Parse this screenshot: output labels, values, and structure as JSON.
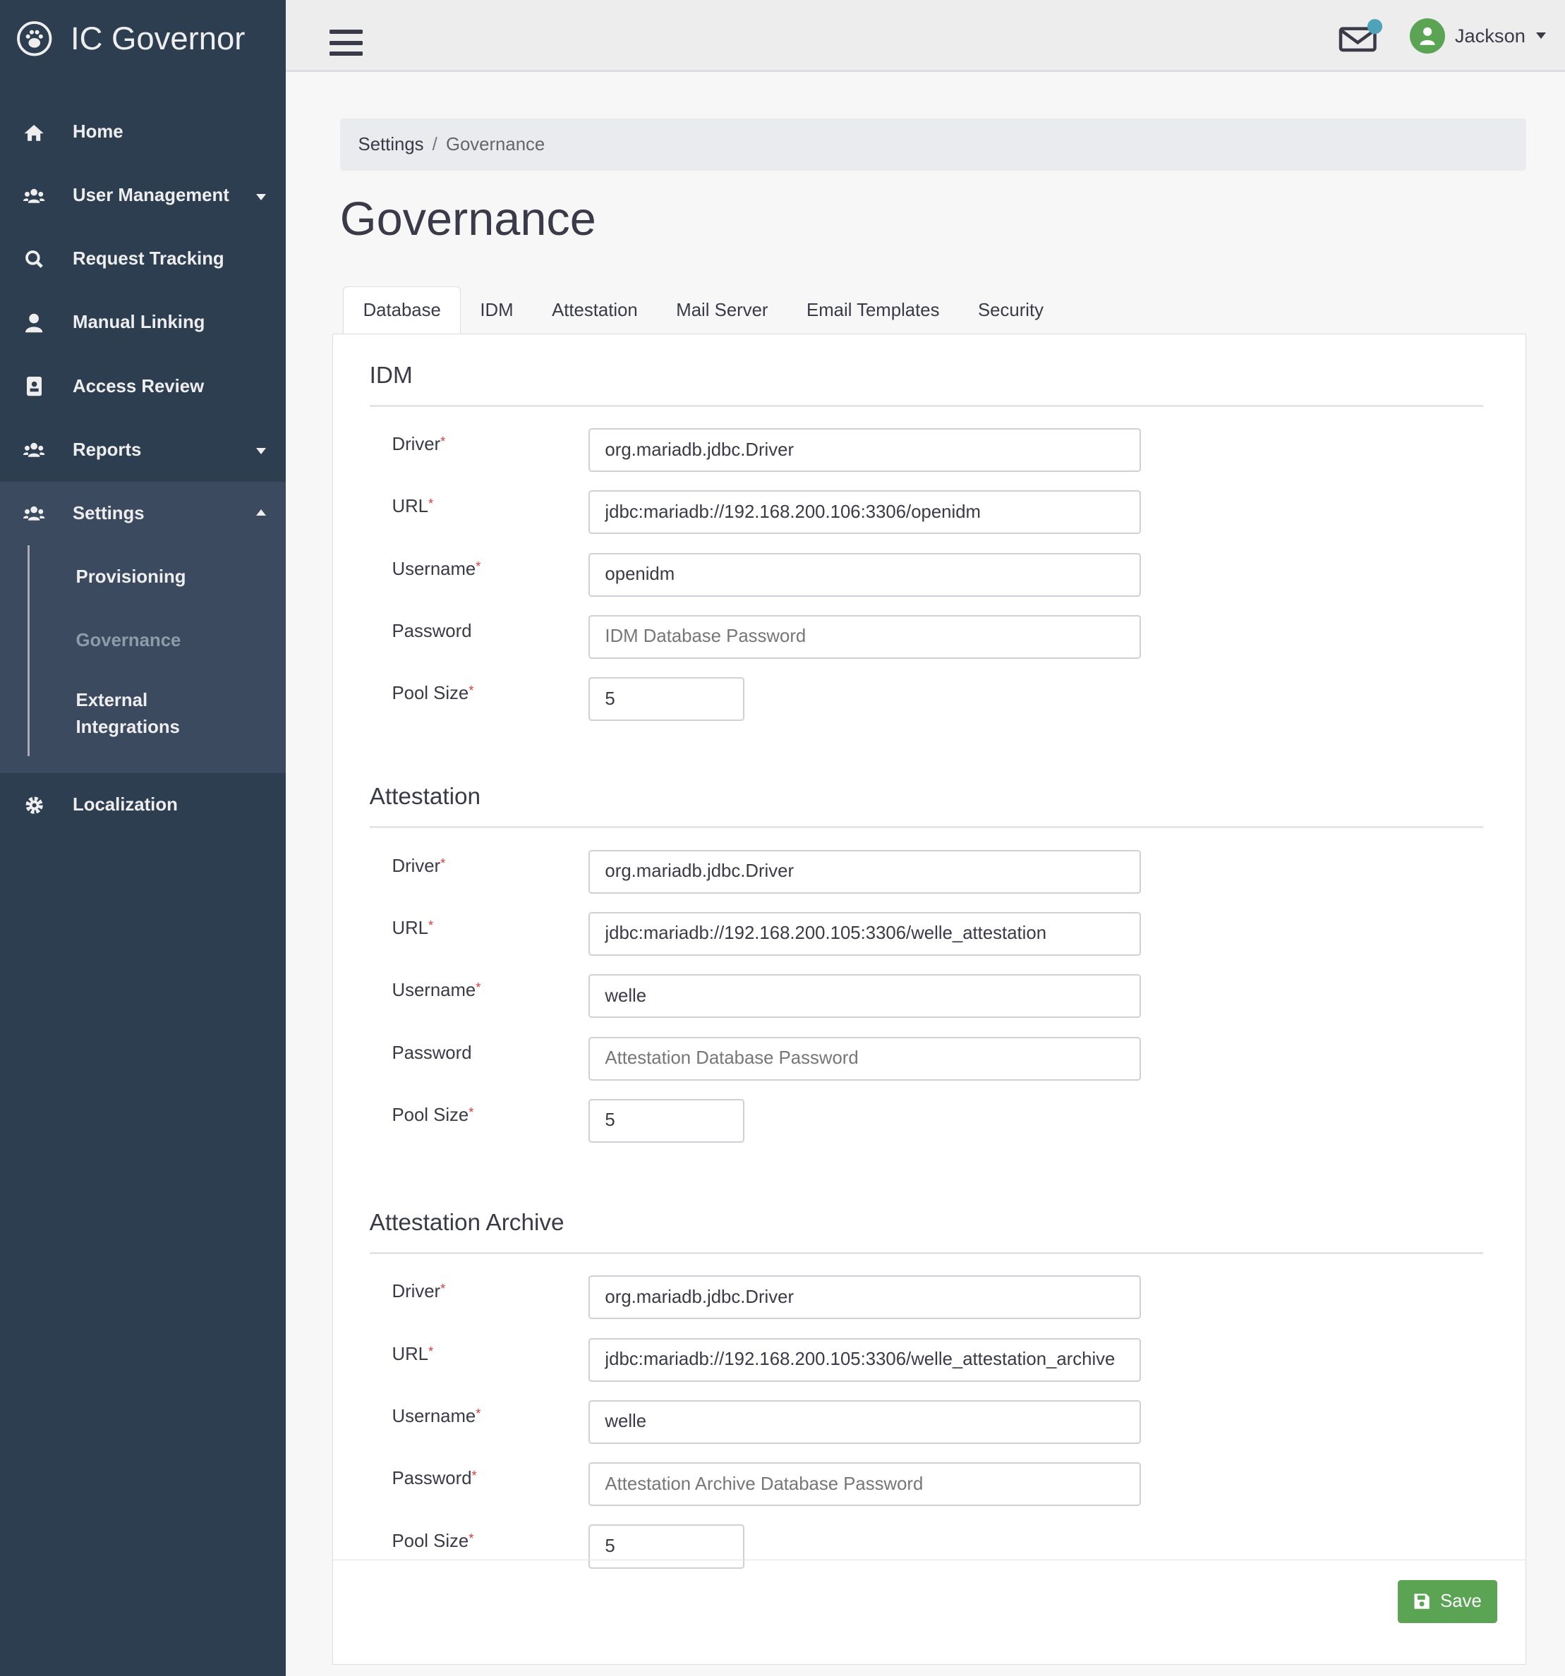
{
  "app": {
    "title": "IC Governor"
  },
  "sidebar": {
    "items": [
      {
        "label": "Home",
        "icon": "home-icon"
      },
      {
        "label": "User Management",
        "icon": "users-icon"
      },
      {
        "label": "Request Tracking",
        "icon": "search-icon"
      },
      {
        "label": "Manual Linking",
        "icon": "user-icon"
      },
      {
        "label": "Access Review",
        "icon": "id-badge-icon"
      },
      {
        "label": "Reports",
        "icon": "users-icon"
      },
      {
        "label": "Settings",
        "icon": "users-icon"
      },
      {
        "label": "Localization",
        "icon": "gear-icon"
      }
    ],
    "settings_sub": [
      {
        "label": "Provisioning"
      },
      {
        "label": "Governance",
        "active": true
      },
      {
        "label": "External Integrations"
      }
    ]
  },
  "header": {
    "user": "Jackson",
    "notification_color": "#4fa3b8"
  },
  "breadcrumb": {
    "parent": "Settings",
    "separator": "/",
    "current": "Governance"
  },
  "page": {
    "title": "Governance"
  },
  "tabs": [
    {
      "label": "Database",
      "active": true
    },
    {
      "label": "IDM"
    },
    {
      "label": "Attestation"
    },
    {
      "label": "Mail Server"
    },
    {
      "label": "Email Templates"
    },
    {
      "label": "Security"
    }
  ],
  "sections": [
    {
      "title": "IDM",
      "fields": [
        {
          "label": "Driver",
          "required": true,
          "value": "org.mariadb.jdbc.Driver",
          "placeholder": ""
        },
        {
          "label": "URL",
          "required": true,
          "value": "jdbc:mariadb://192.168.200.106:3306/openidm",
          "placeholder": ""
        },
        {
          "label": "Username",
          "required": true,
          "value": "openidm",
          "placeholder": ""
        },
        {
          "label": "Password",
          "required": false,
          "value": "",
          "placeholder": "IDM Database Password"
        },
        {
          "label": "Pool Size",
          "required": true,
          "value": "5",
          "placeholder": ""
        }
      ]
    },
    {
      "title": "Attestation",
      "fields": [
        {
          "label": "Driver",
          "required": true,
          "value": "org.mariadb.jdbc.Driver",
          "placeholder": ""
        },
        {
          "label": "URL",
          "required": true,
          "value": "jdbc:mariadb://192.168.200.105:3306/welle_attestation",
          "placeholder": ""
        },
        {
          "label": "Username",
          "required": true,
          "value": "welle",
          "placeholder": ""
        },
        {
          "label": "Password",
          "required": false,
          "value": "",
          "placeholder": "Attestation Database Password"
        },
        {
          "label": "Pool Size",
          "required": true,
          "value": "5",
          "placeholder": ""
        }
      ]
    },
    {
      "title": "Attestation Archive",
      "fields": [
        {
          "label": "Driver",
          "required": true,
          "value": "org.mariadb.jdbc.Driver",
          "placeholder": ""
        },
        {
          "label": "URL",
          "required": true,
          "value": "jdbc:mariadb://192.168.200.105:3306/welle_attestation_archive",
          "placeholder": ""
        },
        {
          "label": "Username",
          "required": true,
          "value": "welle",
          "placeholder": ""
        },
        {
          "label": "Password",
          "required": true,
          "value": "",
          "placeholder": "Attestation Archive Database Password"
        },
        {
          "label": "Pool Size",
          "required": true,
          "value": "5",
          "placeholder": ""
        }
      ]
    }
  ],
  "actions": {
    "save_label": "Save"
  },
  "colors": {
    "sidebar": "#2e3e51",
    "sidebar_group": "#3b4a5e",
    "save": "#5aa454",
    "required": "#e03b3b"
  }
}
